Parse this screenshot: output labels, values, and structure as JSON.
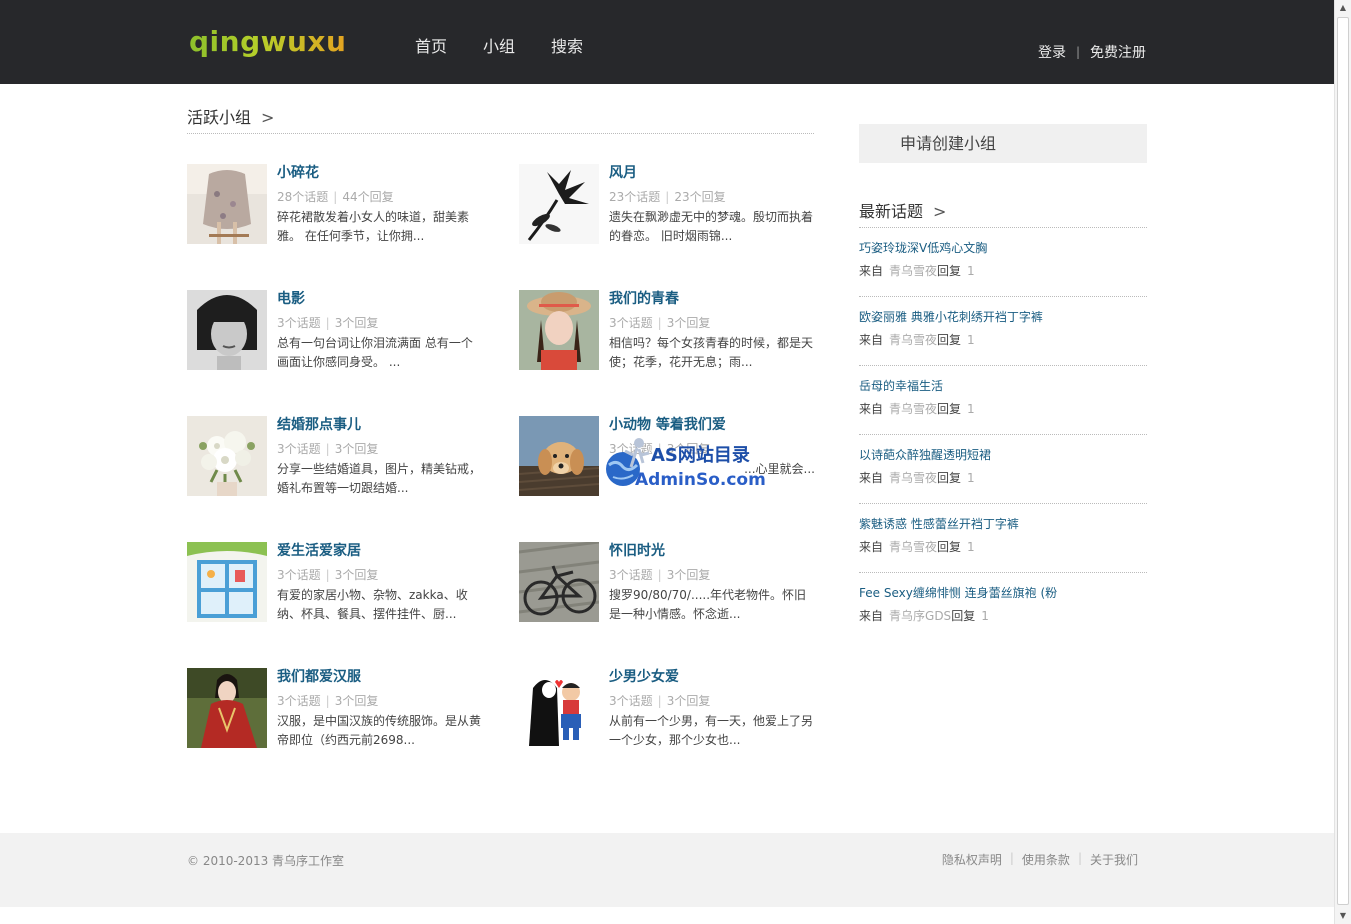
{
  "header": {
    "logo": "qingwuxu",
    "nav": [
      "首页",
      "小组",
      "搜索"
    ],
    "login": "登录",
    "separator": "|",
    "register": "免费注册"
  },
  "main": {
    "section_title": "活跃小组",
    "section_arrow": ">",
    "groups": [
      {
        "title": "小碎花",
        "topics": "28个话题",
        "replies": "44个回复",
        "desc": "碎花裙散发着小女人的味道，甜美素雅。 在任何季节，让你拥...",
        "thumb": "floral-dress-photo"
      },
      {
        "title": "风月",
        "topics": "23个话题",
        "replies": "23个回复",
        "desc": "遗失在飘渺虚无中的梦魂。殷切而执着的眷恋。 旧时烟雨锦...",
        "thumb": "black-flower-photo"
      },
      {
        "title": "电影",
        "topics": "3个话题",
        "replies": "3个回复",
        "desc": "总有一句台词让你泪流满面 总有一个画面让你感同身受。 ...",
        "thumb": "woman-portrait-photo"
      },
      {
        "title": "我们的青春",
        "topics": "3个话题",
        "replies": "3个回复",
        "desc": "相信吗？每个女孩青春的时候，都是天使；花季，花开无息；雨...",
        "thumb": "girl-hat-photo"
      },
      {
        "title": "结婚那点事儿",
        "topics": "3个话题",
        "replies": "3个回复",
        "desc": "分享一些结婚道具，图片，精美钻戒，婚礼布置等一切跟结婚...",
        "thumb": "bouquet-photo"
      },
      {
        "title": "小动物  等着我们爱",
        "topics": "3个话题",
        "replies": "3个回复",
        "desc": "...心里就会...",
        "thumb": "puppy-photo"
      },
      {
        "title": "爱生活爱家居",
        "topics": "3个话题",
        "replies": "3个回复",
        "desc": "有爱的家居小物、杂物、zakka、收纳、杯具、餐具、摆件挂件、厨...",
        "thumb": "cabinet-photo"
      },
      {
        "title": "怀旧时光",
        "topics": "3个话题",
        "replies": "3个回复",
        "desc": "搜罗90/80/70/.....年代老物件。怀旧是一种小情感。怀念逝...",
        "thumb": "bicycle-photo"
      },
      {
        "title": "我们都爱汉服",
        "topics": "3个话题",
        "replies": "3个回复",
        "desc": "汉服，是中国汉族的传统服饰。是从黄帝即位（约西元前2698...",
        "thumb": "hanfu-photo"
      },
      {
        "title": "少男少女爱",
        "topics": "3个话题",
        "replies": "3个回复",
        "desc": "从前有一个少男，有一天，他爱上了另一个少女，那个少女也...",
        "thumb": "cartoon-couple-photo"
      }
    ]
  },
  "sidebar": {
    "create_group": "申请创建小组",
    "latest_title": "最新话题",
    "latest_arrow": ">",
    "topics": [
      {
        "title": "巧姿玲珑深V低鸡心文胸",
        "from": "来自",
        "author": "青乌雪夜",
        "reply_label": "回复",
        "count": "1"
      },
      {
        "title": "欧姿丽雅 典雅小花刺绣开裆丁字裤",
        "from": "来自",
        "author": "青乌雪夜",
        "reply_label": "回复",
        "count": "1"
      },
      {
        "title": "岳母的幸福生活",
        "from": "来自",
        "author": "青乌雪夜",
        "reply_label": "回复",
        "count": "1"
      },
      {
        "title": "以诗葩众醉独醒透明短裙",
        "from": "来自",
        "author": "青乌雪夜",
        "reply_label": "回复",
        "count": "1"
      },
      {
        "title": "紫魅诱惑 性感蕾丝开裆丁字裤",
        "from": "来自",
        "author": "青乌雪夜",
        "reply_label": "回复",
        "count": "1"
      },
      {
        "title": "Fee Sexy缠绵悱恻 连身蕾丝旗袍 (粉",
        "from": "来自",
        "author": "青乌序GDS",
        "reply_label": "回复",
        "count": "1"
      }
    ]
  },
  "watermark": {
    "line1": "AS网站目录",
    "line2": "AdminSo.com"
  },
  "footer": {
    "copyright": "© 2010-2013 青乌序工作室",
    "links": [
      "隐私权声明",
      "使用条款",
      "关于我们"
    ],
    "separator": "|"
  }
}
